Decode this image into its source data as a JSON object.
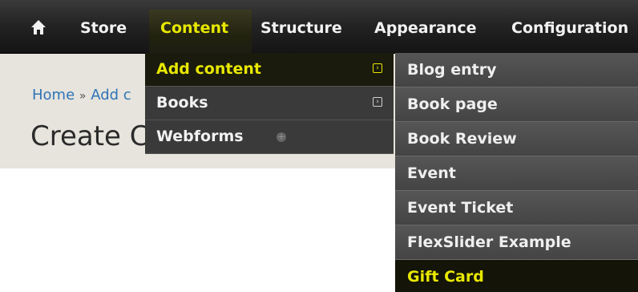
{
  "toolbar": {
    "home_icon": "home-icon",
    "items": [
      {
        "label": "Store",
        "active": false
      },
      {
        "label": "Content",
        "active": true
      },
      {
        "label": "Structure",
        "active": false
      },
      {
        "label": "Appearance",
        "active": false
      },
      {
        "label": "Configuration",
        "active": false
      }
    ],
    "colors": {
      "text": "#f2f2f2",
      "active_text": "#e8e800",
      "background": "#1e1e1e"
    }
  },
  "page": {
    "breadcrumb": {
      "home": "Home",
      "separator": "»",
      "next": "Add c"
    },
    "title": "Create C"
  },
  "content_menu": {
    "items": [
      {
        "label": "Add content",
        "active": true,
        "has_submenu": true
      },
      {
        "label": "Books",
        "active": false,
        "has_submenu": true
      },
      {
        "label": "Webforms",
        "active": false,
        "has_submenu": false
      }
    ]
  },
  "add_content_submenu": {
    "items": [
      {
        "label": "Blog entry",
        "active": false
      },
      {
        "label": "Book page",
        "active": false
      },
      {
        "label": "Book Review",
        "active": false
      },
      {
        "label": "Event",
        "active": false
      },
      {
        "label": "Event Ticket",
        "active": false
      },
      {
        "label": "FlexSlider Example",
        "active": false
      },
      {
        "label": "Gift Card",
        "active": true
      }
    ]
  }
}
